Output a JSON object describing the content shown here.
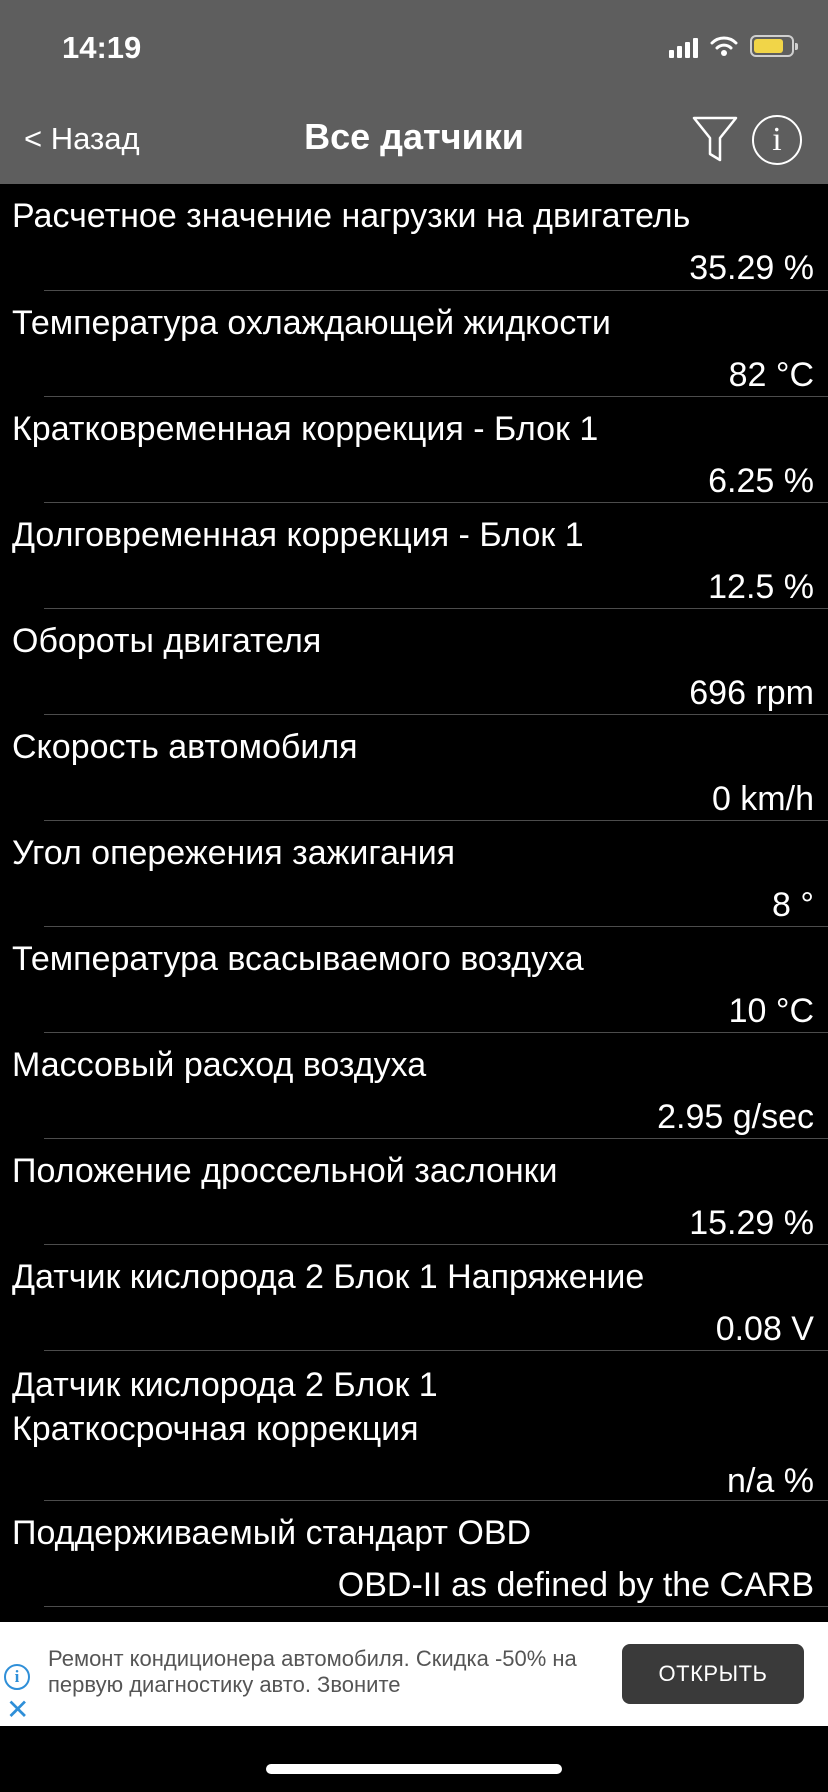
{
  "status_bar": {
    "time": "14:19",
    "battery_color": "#f1d548"
  },
  "header": {
    "back_label": "< Назад",
    "title": "Все датчики",
    "filter_icon": "filter-icon",
    "info_icon": "info-icon",
    "info_glyph": "i"
  },
  "sensors": [
    {
      "label": "Расчетное значение нагрузки на двигатель",
      "value": "35.29 %"
    },
    {
      "label": "Температура охлаждающей жидкости",
      "value": "82 °C"
    },
    {
      "label": "Кратковременная коррекция - Блок 1",
      "value": "6.25 %"
    },
    {
      "label": "Долговременная коррекция - Блок 1",
      "value": "12.5 %"
    },
    {
      "label": "Обороты двигателя",
      "value": "696 rpm"
    },
    {
      "label": "Скорость автомобиля",
      "value": "0 km/h"
    },
    {
      "label": "Угол опережения зажигания",
      "value": "8 °"
    },
    {
      "label": "Температура всасываемого воздуха",
      "value": "10 °C"
    },
    {
      "label": "Массовый расход воздуха",
      "value": "2.95 g/sec"
    },
    {
      "label": "Положение дроссельной заслонки",
      "value": "15.29 %"
    },
    {
      "label": "Датчик кислорода 2 Блок 1 Напряжение",
      "value": "0.08 V"
    },
    {
      "label": "Датчик кислорода 2 Блок 1 Краткосрочная коррекция",
      "value": "n/a %"
    },
    {
      "label": "Поддерживаемый стандарт OBD",
      "value": "OBD-II as defined by the CARB"
    }
  ],
  "ad": {
    "text": "Ремонт кондиционера автомобиля. Скидка -50% на первую диагностику авто. Звоните",
    "button_label": "ОТКРЫТЬ",
    "info_glyph": "i",
    "close_glyph": "✕",
    "accent_color": "#2f8fd8"
  }
}
